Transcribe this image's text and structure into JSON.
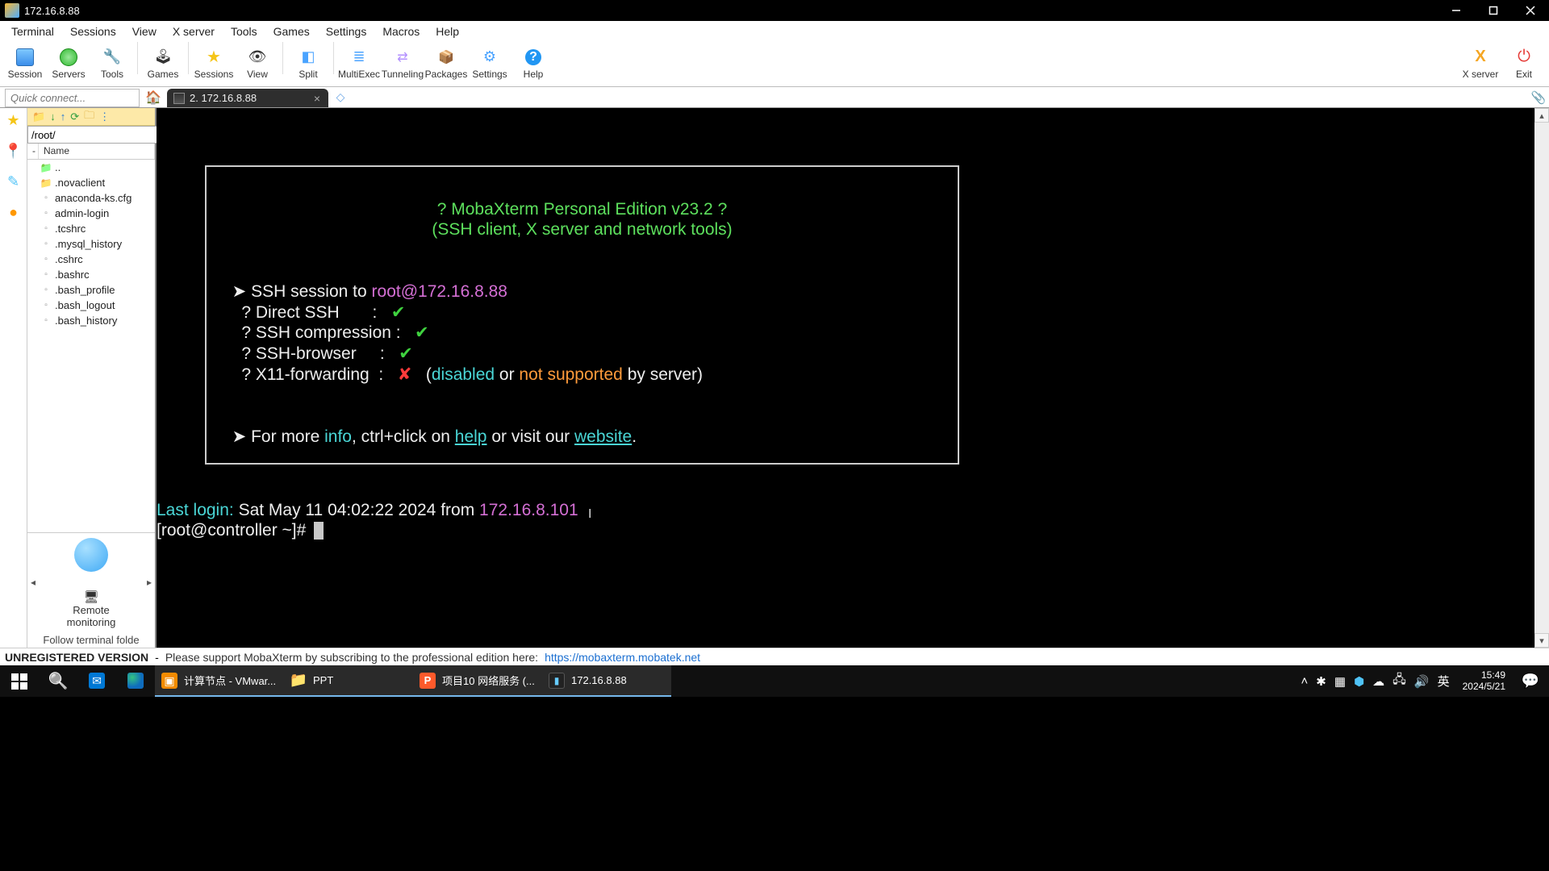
{
  "window": {
    "title": "172.16.8.88"
  },
  "menubar": [
    "Terminal",
    "Sessions",
    "View",
    "X server",
    "Tools",
    "Games",
    "Settings",
    "Macros",
    "Help"
  ],
  "toolbar": {
    "left": [
      {
        "label": "Session",
        "name": "session-button",
        "icon": "ico-monitor"
      },
      {
        "label": "Servers",
        "name": "servers-button",
        "icon": "ico-globe"
      },
      {
        "label": "Tools",
        "name": "tools-button",
        "icon": "ico-wrench"
      },
      {
        "label": "Games",
        "name": "games-button",
        "icon": "ico-joystick"
      },
      {
        "label": "Sessions",
        "name": "sessions-button",
        "icon": "ico-star"
      },
      {
        "label": "View",
        "name": "view-button",
        "icon": "ico-eye"
      },
      {
        "label": "Split",
        "name": "split-button",
        "icon": "ico-split"
      },
      {
        "label": "MultiExec",
        "name": "multiexec-button",
        "icon": "ico-multi"
      },
      {
        "label": "Tunneling",
        "name": "tunneling-button",
        "icon": "ico-net"
      },
      {
        "label": "Packages",
        "name": "packages-button",
        "icon": "ico-pkg"
      },
      {
        "label": "Settings",
        "name": "settings-button",
        "icon": "ico-gear"
      },
      {
        "label": "Help",
        "name": "help-button",
        "icon": "ico-help"
      }
    ],
    "right": [
      {
        "label": "X server",
        "name": "xserver-button",
        "icon": "ico-x"
      },
      {
        "label": "Exit",
        "name": "exit-button",
        "icon": "ico-exit"
      }
    ]
  },
  "quick_connect": {
    "placeholder": "Quick connect..."
  },
  "tab": {
    "label": "2. 172.16.8.88"
  },
  "sidebar": {
    "path": "/root/",
    "header": {
      "expand": "-",
      "name": "Name"
    },
    "files": [
      {
        "name": "..",
        "type": "folder-up"
      },
      {
        "name": ".novaclient",
        "type": "folder"
      },
      {
        "name": "anaconda-ks.cfg",
        "type": "file"
      },
      {
        "name": "admin-login",
        "type": "file"
      },
      {
        "name": ".tcshrc",
        "type": "file"
      },
      {
        "name": ".mysql_history",
        "type": "file"
      },
      {
        "name": ".cshrc",
        "type": "file"
      },
      {
        "name": ".bashrc",
        "type": "file"
      },
      {
        "name": ".bash_profile",
        "type": "file"
      },
      {
        "name": ".bash_logout",
        "type": "file"
      },
      {
        "name": ".bash_history",
        "type": "file"
      }
    ],
    "remote": {
      "line1": "Remote",
      "line2": "monitoring"
    },
    "follow": "Follow terminal folde"
  },
  "terminal": {
    "banner": {
      "title": "? MobaXterm Personal Edition v23.2 ?",
      "subtitle": "(SSH client, X server and network tools)",
      "session_prefix": "SSH session to ",
      "session_target": "root@172.16.8.88",
      "rows": [
        {
          "label": "Direct SSH       :",
          "ok": true
        },
        {
          "label": "SSH compression :",
          "ok": true
        },
        {
          "label": "SSH-browser     :",
          "ok": true
        },
        {
          "label": "X11-forwarding  :",
          "ok": false,
          "extra_disabled": "disabled",
          "extra_or": " or ",
          "extra_not": "not supported",
          "extra_tail": " by server)"
        }
      ],
      "more1": "For more ",
      "more_info": "info",
      "more2": ", ctrl+click on ",
      "more_help": "help",
      "more3": " or visit our ",
      "more_site": "website",
      "more4": "."
    },
    "lastlogin_label": "Last login:",
    "lastlogin_rest": " Sat May 11 04:02:22 2024 from ",
    "lastlogin_ip": "172.16.8.101",
    "prompt": "[root@controller ~]# "
  },
  "statusbar": {
    "unreg": "UNREGISTERED VERSION",
    "dash": "  -  ",
    "msg": "Please support MobaXterm by subscribing to the professional edition here:  ",
    "url": "https://mobaxterm.mobatek.net"
  },
  "taskbar": {
    "apps": [
      {
        "label": "",
        "name": "taskbar-mail",
        "icon": "mail-ico"
      },
      {
        "label": "",
        "name": "taskbar-edge",
        "icon": "edge-ico"
      },
      {
        "label": "计算节点 - VMwar...",
        "name": "taskbar-vmware",
        "icon": "vm-ico",
        "active": true
      },
      {
        "label": "PPT",
        "name": "taskbar-ppt",
        "icon": "folder-ico",
        "active": true
      },
      {
        "label": "项目10 网络服务 (...",
        "name": "taskbar-wps",
        "icon": "wps-ico",
        "active": true
      },
      {
        "label": "172.16.8.88",
        "name": "taskbar-mobaxterm",
        "icon": "moba-ico",
        "active": true
      }
    ],
    "ime": "英",
    "clock": {
      "time": "15:49",
      "date": "2024/5/21"
    }
  }
}
